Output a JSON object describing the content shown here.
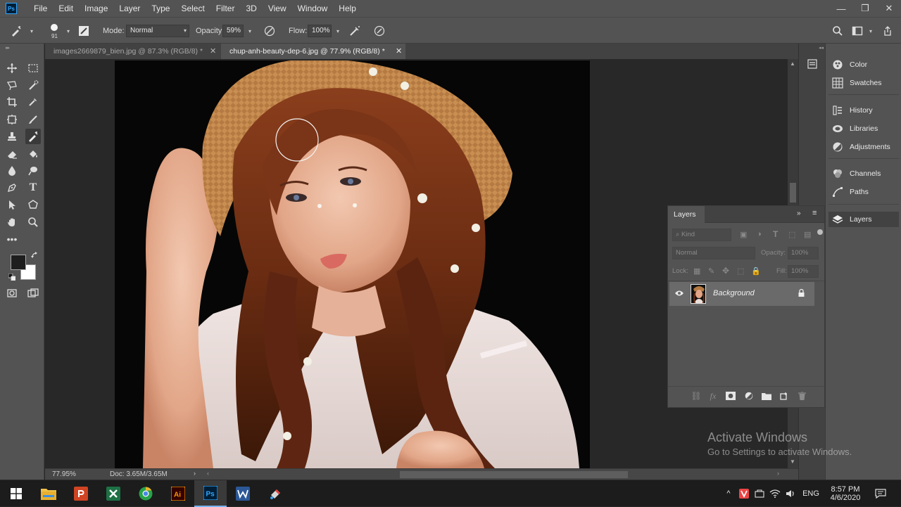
{
  "app": {
    "logo_text": "Ps",
    "menu": [
      "File",
      "Edit",
      "Image",
      "Layer",
      "Type",
      "Select",
      "Filter",
      "3D",
      "View",
      "Window",
      "Help"
    ],
    "window_controls": {
      "minimize": "—",
      "restore": "❐",
      "close": "✕"
    }
  },
  "options_bar": {
    "brush_size": "91",
    "mode_label": "Mode:",
    "mode_value": "Normal",
    "opacity_label": "Opacity:",
    "opacity_value": "59%",
    "flow_label": "Flow:",
    "flow_value": "100%"
  },
  "tabs": [
    {
      "label": "images2669879_bien.jpg @ 87.3% (RGB/8) *",
      "close": "✕",
      "active": false
    },
    {
      "label": "chup-anh-beauty-dep-6.jpg @ 77.9% (RGB/8) *",
      "close": "✕",
      "active": true
    }
  ],
  "status": {
    "zoom": "77.95%",
    "doc": "Doc: 3.65M/3.65M"
  },
  "panel_dock": {
    "items": [
      {
        "label": "Color",
        "icon": "color-icon"
      },
      {
        "label": "Swatches",
        "icon": "swatches-icon"
      },
      {
        "label": "History",
        "icon": "history-icon"
      },
      {
        "label": "Libraries",
        "icon": "libraries-icon"
      },
      {
        "label": "Adjustments",
        "icon": "adjustments-icon"
      },
      {
        "label": "Channels",
        "icon": "channels-icon"
      },
      {
        "label": "Paths",
        "icon": "paths-icon"
      },
      {
        "label": "Layers",
        "icon": "layers-icon"
      }
    ]
  },
  "layers_panel": {
    "title": "Layers",
    "filter_placeholder": "Kind",
    "blend_mode": "Normal",
    "opacity_label": "Opacity:",
    "opacity_value": "100%",
    "lock_label": "Lock:",
    "fill_label": "Fill:",
    "fill_value": "100%",
    "layer_name": "Background"
  },
  "watermark": {
    "title": "Activate Windows",
    "subtitle": "Go to Settings to activate Windows."
  },
  "taskbar": {
    "language": "ENG",
    "time": "8:57 PM",
    "date": "4/6/2020"
  },
  "colors": {
    "ui_dark": "#535353",
    "ui_darker": "#424242",
    "canvas_bg": "#282828",
    "accent": "#31a8ff"
  }
}
